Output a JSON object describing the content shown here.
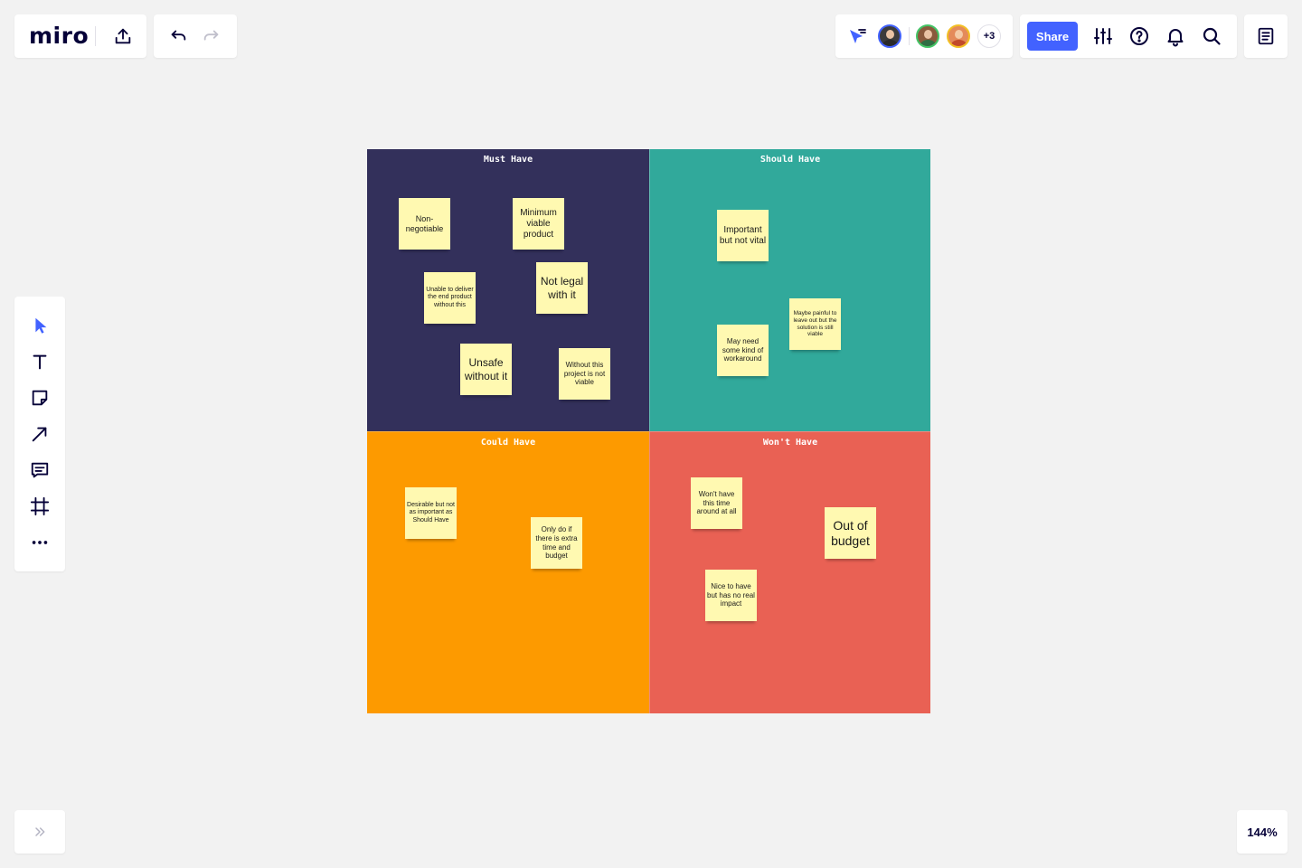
{
  "brand": {
    "logo": "miro"
  },
  "collaborators": {
    "more_count": "+3"
  },
  "toolbar": {
    "share_label": "Share"
  },
  "zoom": {
    "level": "144%"
  },
  "board": {
    "quadrants": [
      {
        "title": "Must Have",
        "color": "#33305b",
        "stickies": [
          "Non-negotiable",
          "Minimum viable product",
          "Unable to deliver the end product without this",
          "Not legal with it",
          "Unsafe without it",
          "Without this project is not viable"
        ]
      },
      {
        "title": "Should Have",
        "color": "#31a99b",
        "stickies": [
          "Important but not vital",
          "Maybe painful to leave out but the solution is still viable",
          "May need some kind of workaround"
        ]
      },
      {
        "title": "Could Have",
        "color": "#fd9a00",
        "stickies": [
          "Desirable but not as important as Should Have",
          "Only do if there is extra time and budget"
        ]
      },
      {
        "title": "Won't Have",
        "color": "#e96154",
        "stickies": [
          "Won't have this time around at all",
          "Out of budget",
          "Nice to have but has no real impact"
        ]
      }
    ]
  },
  "icons": {
    "export": "upload-icon",
    "undo": "undo-icon",
    "redo": "redo-icon",
    "follow": "cursor-follow-icon",
    "settings": "sliders-icon",
    "help": "question-circle-icon",
    "notifications": "bell-icon",
    "search": "search-icon",
    "notes": "document-icon",
    "tools": [
      "select-cursor-icon",
      "text-icon",
      "sticky-note-icon",
      "arrow-line-icon",
      "comment-icon",
      "frame-icon",
      "more-horizontal-icon"
    ],
    "expand": "double-chevron-right-icon"
  },
  "colors": {
    "accent": "#4262ff",
    "sticky": "#fff9b1",
    "canvas": "#f2f2f2"
  }
}
